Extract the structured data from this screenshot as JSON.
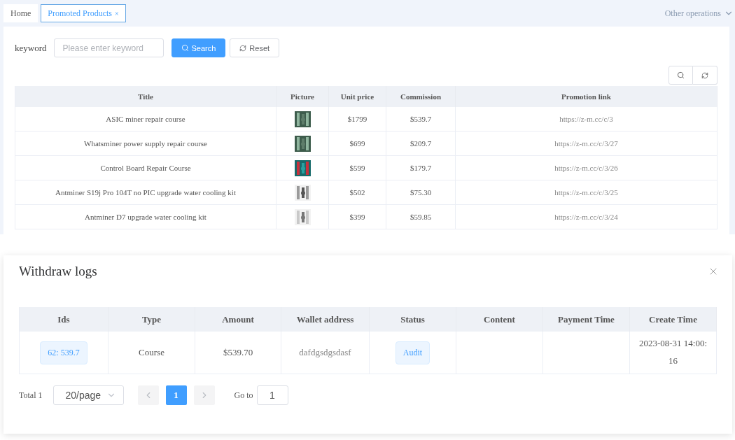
{
  "tabs": [
    {
      "label": "Home",
      "selected": false,
      "closable": false
    },
    {
      "label": "Promoted Products",
      "selected": true,
      "closable": true,
      "close": "×"
    }
  ],
  "other_operations": "Other operations",
  "search": {
    "label": "keyword",
    "placeholder": "Please enter keyword",
    "search_button": "Search",
    "reset_button": "Reset"
  },
  "products_table": {
    "columns": [
      "Title",
      "Picture",
      "Unit price",
      "Commission",
      "Promotion link"
    ],
    "rows": [
      {
        "title": "ASIC miner repair course",
        "unit_price": "$1799",
        "commission": "$539.7",
        "link": "https://z-m.cc/c/3"
      },
      {
        "title": "Whatsminer power supply repair course",
        "unit_price": "$699",
        "commission": "$209.7",
        "link": "https://z-m.cc/c/3/27"
      },
      {
        "title": "Control Board Repair Course",
        "unit_price": "$599",
        "commission": "$179.7",
        "link": "https://z-m.cc/c/3/26"
      },
      {
        "title": "Antminer S19j Pro 104T no PIC upgrade water cooling kit",
        "unit_price": "$502",
        "commission": "$75.30",
        "link": "https://z-m.cc/c/3/25"
      },
      {
        "title": "Antminer D7 upgrade water cooling kit",
        "unit_price": "$399",
        "commission": "$59.85",
        "link": "https://z-m.cc/c/3/24"
      }
    ]
  },
  "dialog": {
    "title": "Withdraw logs",
    "columns": [
      "Ids",
      "Type",
      "Amount",
      "Wallet address",
      "Status",
      "Content",
      "Payment Time",
      "Create Time"
    ],
    "rows": [
      {
        "ids": "62: 539.7",
        "type": "Course",
        "amount": "$539.70",
        "wallet": "dafdgsdgsdasf",
        "status": "Audit",
        "create_time": "2023-08-31 14:00:16"
      }
    ],
    "pagination": {
      "total": "Total 1",
      "page_size": "20/page",
      "pages": [
        {
          "label": "1",
          "selected": true
        }
      ],
      "goto_label": "Go to",
      "goto_value": "1"
    }
  }
}
